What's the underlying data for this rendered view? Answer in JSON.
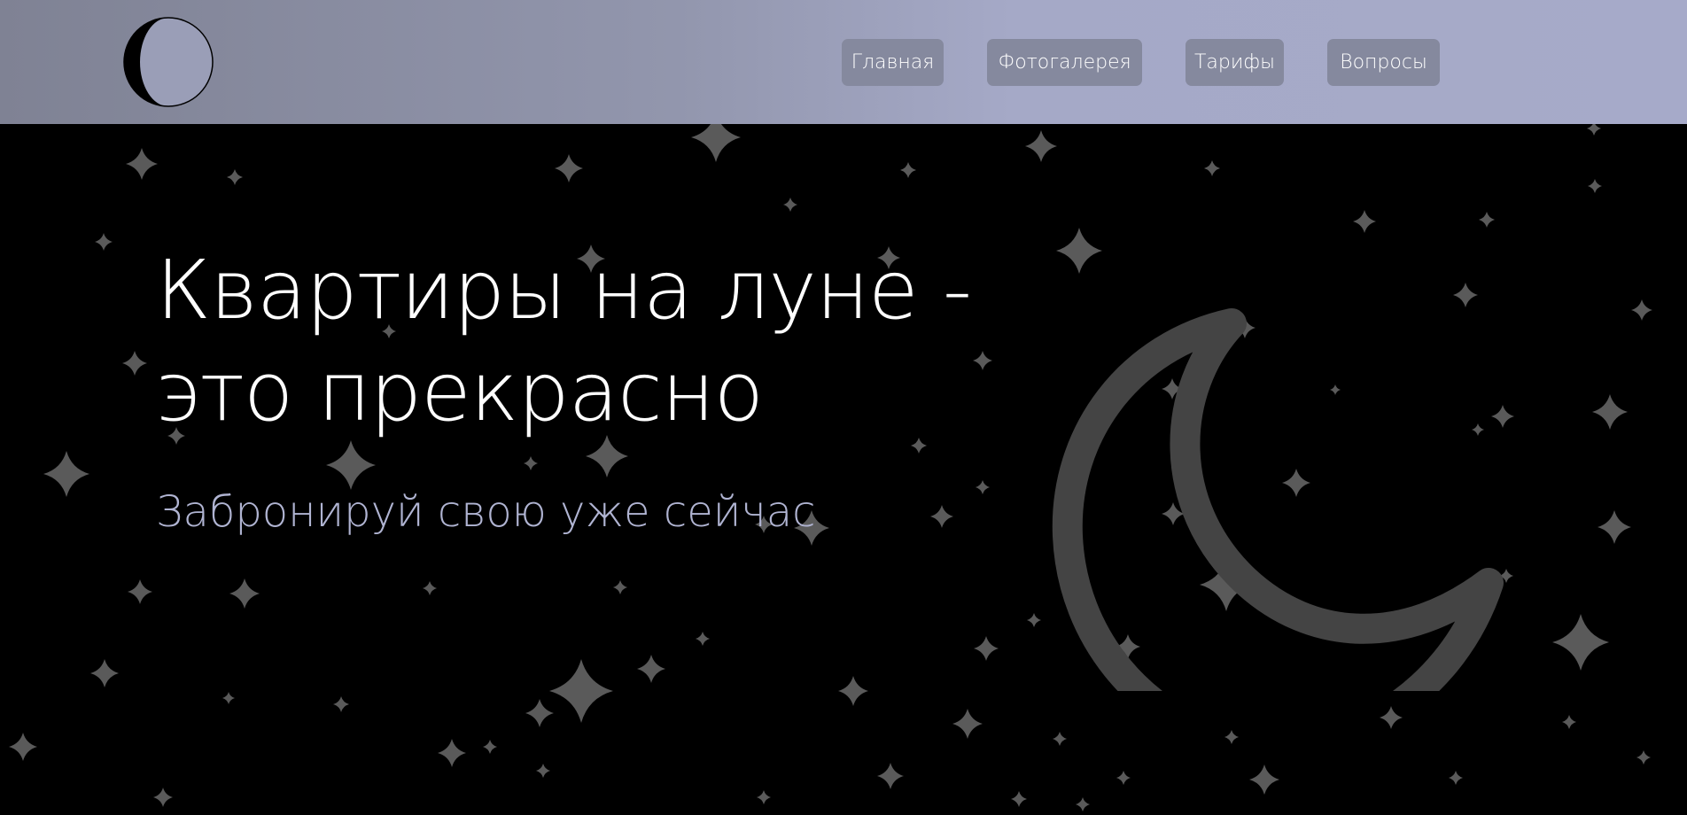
{
  "header": {
    "logo_icon": "crescent-moon-logo-icon",
    "nav": [
      {
        "label": "Главная"
      },
      {
        "label": "Фотогалерея"
      },
      {
        "label": "Тарифы"
      },
      {
        "label": "Вопросы"
      }
    ]
  },
  "hero": {
    "title_line1": "Квартиры на луне -",
    "title_line2": "это прекрасно",
    "subtitle": "Забронируй свою уже сейчас",
    "background_icon": "stars-icon",
    "moon_icon": "crescent-moon-icon"
  },
  "colors": {
    "header_gradient_start": "#7f8294",
    "header_gradient_end": "#a6aac9",
    "nav_button_bg": "#85899e",
    "hero_bg": "#000000",
    "title_color": "#ffffff",
    "subtitle_color": "#b0b4d2",
    "star_color": "#5a5a5a",
    "moon_stroke": "#444444"
  }
}
